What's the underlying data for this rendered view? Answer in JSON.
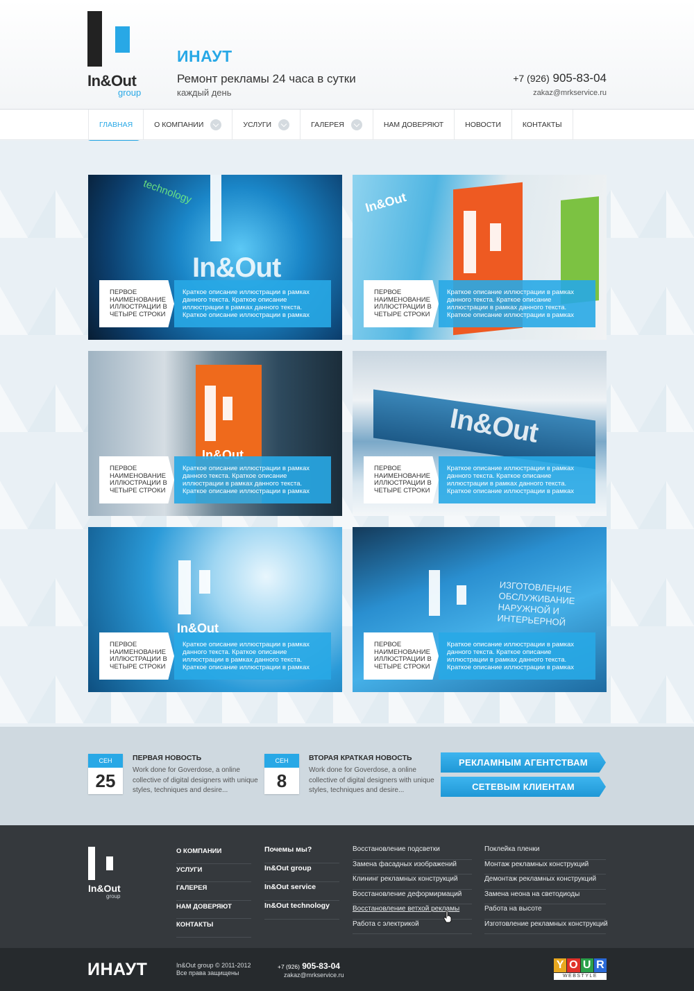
{
  "header": {
    "logo_brand": "In&Out",
    "logo_sub": "group",
    "site_name": "ИНАУТ",
    "tagline": "Ремонт рекламы 24 часа в сутки",
    "tagline_sub": "каждый день",
    "phone_code": "+7 (926)",
    "phone_number": "905-83-04",
    "email": "zakaz@mrkservice.ru"
  },
  "nav": {
    "items": [
      {
        "label": "ГЛАВНАЯ"
      },
      {
        "label": "О КОМПАНИИ"
      },
      {
        "label": "УСЛУГИ"
      },
      {
        "label": "ГАЛЕРЕЯ"
      },
      {
        "label": "НАМ ДОВЕРЯЮТ"
      },
      {
        "label": "НОВОСТИ"
      },
      {
        "label": "КОНТАКТЫ"
      }
    ]
  },
  "gallery": {
    "cards": [
      {
        "title": "ПЕРВОЕ НАИМЕНОВАНИЕ ИЛЛЮСТРАЦИИ В ЧЕТЫРЕ СТРОКИ",
        "desc": "Краткое описание иллюстрации в рамках данного текста. Краткое описание иллюстрации в рамках данного текста. Краткое описание иллюстрации в рамках",
        "sign": "In&Out",
        "extra": "technology"
      },
      {
        "title": "ПЕРВОЕ НАИМЕНОВАНИЕ ИЛЛЮСТРАЦИИ В ЧЕТЫРЕ СТРОКИ",
        "desc": "Краткое описание иллюстрации в рамках данного текста. Краткое описание иллюстрации в рамках данного текста. Краткое описание иллюстрации в рамках",
        "sign": "In&Out",
        "extra": ""
      },
      {
        "title": "ПЕРВОЕ НАИМЕНОВАНИЕ ИЛЛЮСТРАЦИИ В ЧЕТЫРЕ СТРОКИ",
        "desc": "Краткое описание иллюстрации в рамках данного текста. Краткое описание иллюстрации в рамках данного текста. Краткое описание иллюстрации в рамках",
        "sign": "In&Out",
        "extra": ""
      },
      {
        "title": "ПЕРВОЕ НАИМЕНОВАНИЕ ИЛЛЮСТРАЦИИ В ЧЕТЫРЕ СТРОКИ",
        "desc": "Краткое описание иллюстрации в рамках данного текста. Краткое описание иллюстрации в рамках данного текста. Краткое описание иллюстрации в рамках",
        "sign": "In&Out",
        "extra": ""
      },
      {
        "title": "ПЕРВОЕ НАИМЕНОВАНИЕ ИЛЛЮСТРАЦИИ В ЧЕТЫРЕ СТРОКИ",
        "desc": "Краткое описание иллюстрации в рамках данного текста. Краткое описание иллюстрации в рамках данного текста. Краткое описание иллюстрации в рамках",
        "sign": "In&Out",
        "extra": ""
      },
      {
        "title": "ПЕРВОЕ НАИМЕНОВАНИЕ ИЛЛЮСТРАЦИИ В ЧЕТЫРЕ СТРОКИ",
        "desc": "Краткое описание иллюстрации в рамках данного текста. Краткое описание иллюстрации в рамках данного текста. Краткое описание иллюстрации в рамках",
        "sign": "ИЗГОТОВЛЕНИЕ ОБСЛУЖИВАНИЕ НАРУЖНОЙ И ИНТЕРЬЕРНОЙ",
        "extra": ""
      }
    ]
  },
  "news": [
    {
      "month": "СЕН",
      "day": "25",
      "title": "ПЕРВАЯ НОВОСТЬ",
      "text": "Work done for Goverdose, a online collective of digital designers with unique styles, techniques and desire..."
    },
    {
      "month": "СЕН",
      "day": "8",
      "title": "ВТОРАЯ КРАТКАЯ НОВОСТЬ",
      "text": "Work done for Goverdose, a online collective of digital designers with unique styles, techniques and desire..."
    }
  ],
  "cta": {
    "agencies": "РЕКЛАМНЫМ АГЕНТСТВАМ",
    "networks": "СЕТЕВЫМ КЛИЕНТАМ"
  },
  "footer": {
    "logo_brand": "In&Out",
    "logo_sub": "group",
    "col1": [
      "О КОМПАНИИ",
      "УСЛУГИ",
      "ГАЛЕРЕЯ",
      "НАМ ДОВЕРЯЮТ",
      "КОНТАКТЫ"
    ],
    "col2": [
      "Почемы мы?",
      "In&Out group",
      "In&Out service",
      "In&Out technology"
    ],
    "col3": [
      "Восстановление подсветки",
      "Замена фасадных изображений",
      "Клининг рекламных конструкций",
      "Восстановление деформирмаций",
      "Восстановление ветхой рекламы",
      "Работа с электрикой"
    ],
    "col4": [
      "Поклейка пленки",
      "Монтаж рекламных конструкций",
      "Демонтаж рекламных конструкций",
      "Замена неона на светодиоды",
      "Работа на высоте",
      "Изготовление рекламных конструкций"
    ]
  },
  "bottom": {
    "name": "ИНАУТ",
    "copy1": "In&Out group © 2011-2012",
    "copy2": "Все права защищены",
    "phone_code": "+7 (926)",
    "phone_number": "905-83-04",
    "email": "zakaz@mrkservice.ru",
    "badge_letters": [
      "Y",
      "O",
      "U",
      "R"
    ],
    "badge_colors": [
      "#e8a820",
      "#e0322a",
      "#2aa04a",
      "#2a6ad8"
    ],
    "badge_sub": "WEBSTYLE"
  }
}
